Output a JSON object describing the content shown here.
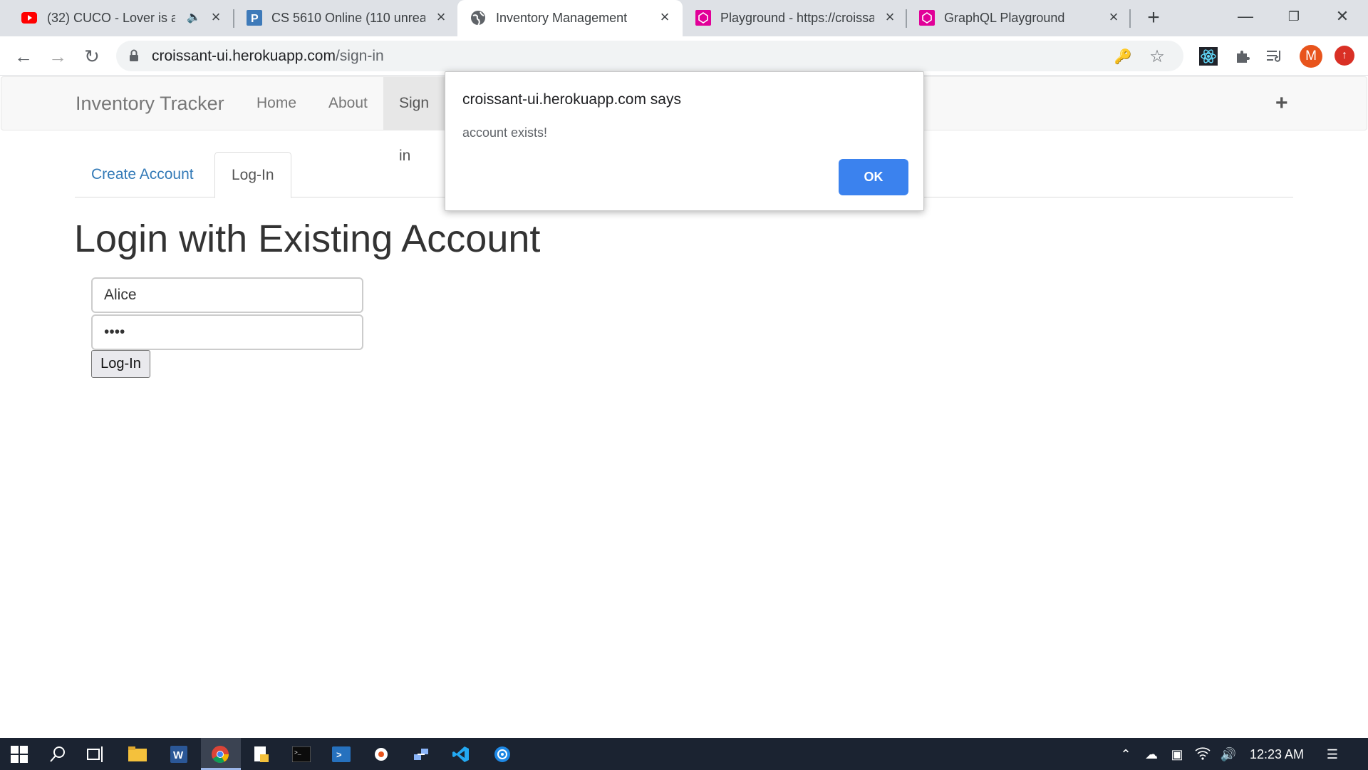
{
  "browser": {
    "tabs": [
      {
        "title": "(32) CUCO - Lover is a D",
        "favicon": "youtube-icon",
        "active": false
      },
      {
        "title": "CS 5610 Online (110 unread",
        "favicon": "piazza-icon",
        "active": false
      },
      {
        "title": "Inventory Management",
        "favicon": "globe-icon",
        "active": true
      },
      {
        "title": "Playground - https://croissa",
        "favicon": "graphql-icon",
        "active": false
      },
      {
        "title": "GraphQL Playground",
        "favicon": "graphql-icon",
        "active": false
      }
    ],
    "url_host": "croissant-ui.herokuapp.com",
    "url_path": "/sign-in",
    "profile_initial": "M"
  },
  "navbar": {
    "brand": "Inventory Tracker",
    "links": [
      "Home",
      "About",
      "Sign in"
    ]
  },
  "page": {
    "tabs": [
      "Create Account",
      "Log-In"
    ],
    "heading": "Login with Existing Account",
    "username_value": "Alice",
    "password_value": "••••",
    "submit_label": "Log-In"
  },
  "alert": {
    "title": "croissant-ui.herokuapp.com says",
    "message": "account exists!",
    "ok_label": "OK"
  },
  "taskbar": {
    "clock": "12:23 AM"
  },
  "colors": {
    "accent": "#3b82ee",
    "link": "#337ab7",
    "taskbar": "#1b2331"
  }
}
